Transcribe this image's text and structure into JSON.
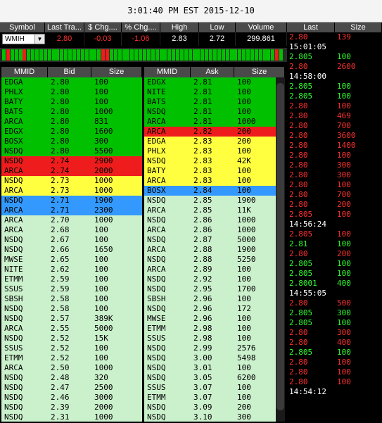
{
  "title": "3:01:40 PM EST 2015-12-10",
  "quote": {
    "headers": [
      "Symbol",
      "Last Tra...",
      "$ Chg....",
      "% Chg....",
      "High",
      "Low",
      "Volume"
    ],
    "symbol": "WMIH",
    "last": "2.80",
    "chg": "-0.03",
    "pct_chg": "-1.06",
    "high": "2.83",
    "low": "2.72",
    "volume": "299.861"
  },
  "colors": {
    "green": "#00c000",
    "red": "#ee1c1c",
    "yellow": "#ffff40",
    "blue": "#3399ff",
    "light_green": "#cbf0cc",
    "price_red": "#ff3030",
    "price_green": "#30ff30"
  },
  "tick_colors": [
    "g",
    "r",
    "g",
    "g",
    "g",
    "r",
    "g",
    "g",
    "g",
    "g",
    "g",
    "g",
    "g",
    "g",
    "g",
    "g",
    "g",
    "g",
    "g",
    "g",
    "g",
    "g",
    "g",
    "g",
    "r",
    "r",
    "g",
    "g",
    "g",
    "g",
    "g",
    "g",
    "g",
    "g",
    "g",
    "g",
    "g",
    "g",
    "g",
    "g",
    "g",
    "g",
    "g",
    "g",
    "g",
    "g",
    "g",
    "g",
    "g",
    "g",
    "g",
    "g",
    "g",
    "g",
    "g",
    "g",
    "g",
    "g",
    "g",
    "g",
    "g",
    "g",
    "g",
    "g",
    "g",
    "g",
    "r",
    "g"
  ],
  "bid_book": {
    "headers": [
      "MMID",
      "Bid",
      "Size"
    ],
    "rows": [
      {
        "mmid": "EDGA",
        "price": "2.80",
        "size": "100",
        "level": "green"
      },
      {
        "mmid": "PHLX",
        "price": "2.80",
        "size": "100",
        "level": "green"
      },
      {
        "mmid": "BATY",
        "price": "2.80",
        "size": "100",
        "level": "green"
      },
      {
        "mmid": "BATS",
        "price": "2.80",
        "size": "1000",
        "level": "green"
      },
      {
        "mmid": "ARCA",
        "price": "2.80",
        "size": "831",
        "level": "green"
      },
      {
        "mmid": "EDGX",
        "price": "2.80",
        "size": "1600",
        "level": "green"
      },
      {
        "mmid": "BOSX",
        "price": "2.80",
        "size": "300",
        "level": "green"
      },
      {
        "mmid": "NSDQ",
        "price": "2.80",
        "size": "5500",
        "level": "green"
      },
      {
        "mmid": "NSDQ",
        "price": "2.74",
        "size": "2900",
        "level": "red"
      },
      {
        "mmid": "ARCA",
        "price": "2.74",
        "size": "2000",
        "level": "red"
      },
      {
        "mmid": "NSDQ",
        "price": "2.73",
        "size": "1000",
        "level": "yellow"
      },
      {
        "mmid": "ARCA",
        "price": "2.73",
        "size": "1000",
        "level": "yellow"
      },
      {
        "mmid": "NSDQ",
        "price": "2.71",
        "size": "1900",
        "level": "blue"
      },
      {
        "mmid": "ARCA",
        "price": "2.71",
        "size": "2300",
        "level": "blue"
      },
      {
        "mmid": "ARCA",
        "price": "2.70",
        "size": "1000",
        "level": "light"
      },
      {
        "mmid": "ARCA",
        "price": "2.68",
        "size": "100",
        "level": "light"
      },
      {
        "mmid": "NSDQ",
        "price": "2.67",
        "size": "100",
        "level": "light"
      },
      {
        "mmid": "NSDQ",
        "price": "2.66",
        "size": "1650",
        "level": "light"
      },
      {
        "mmid": "MWSE",
        "price": "2.65",
        "size": "100",
        "level": "light"
      },
      {
        "mmid": "NITE",
        "price": "2.62",
        "size": "100",
        "level": "light"
      },
      {
        "mmid": "ETMM",
        "price": "2.59",
        "size": "100",
        "level": "light"
      },
      {
        "mmid": "SSUS",
        "price": "2.59",
        "size": "100",
        "level": "light"
      },
      {
        "mmid": "SBSH",
        "price": "2.58",
        "size": "100",
        "level": "light"
      },
      {
        "mmid": "NSDQ",
        "price": "2.58",
        "size": "100",
        "level": "light"
      },
      {
        "mmid": "NSDQ",
        "price": "2.57",
        "size": "389K",
        "level": "light"
      },
      {
        "mmid": "ARCA",
        "price": "2.55",
        "size": "5000",
        "level": "light"
      },
      {
        "mmid": "NSDQ",
        "price": "2.52",
        "size": "15K",
        "level": "light"
      },
      {
        "mmid": "SSUS",
        "price": "2.52",
        "size": "100",
        "level": "light"
      },
      {
        "mmid": "ETMM",
        "price": "2.52",
        "size": "100",
        "level": "light"
      },
      {
        "mmid": "ARCA",
        "price": "2.50",
        "size": "1000",
        "level": "light"
      },
      {
        "mmid": "NSDQ",
        "price": "2.48",
        "size": "320",
        "level": "light"
      },
      {
        "mmid": "NSDQ",
        "price": "2.47",
        "size": "2500",
        "level": "light"
      },
      {
        "mmid": "NSDQ",
        "price": "2.46",
        "size": "3000",
        "level": "light"
      },
      {
        "mmid": "NSDQ",
        "price": "2.39",
        "size": "2000",
        "level": "light"
      },
      {
        "mmid": "NSDQ",
        "price": "2.31",
        "size": "1000",
        "level": "light"
      }
    ]
  },
  "ask_book": {
    "headers": [
      "MMID",
      "Ask",
      "Size"
    ],
    "rows": [
      {
        "mmid": "EDGX",
        "price": "2.81",
        "size": "100",
        "level": "green"
      },
      {
        "mmid": "NITE",
        "price": "2.81",
        "size": "100",
        "level": "green"
      },
      {
        "mmid": "BATS",
        "price": "2.81",
        "size": "100",
        "level": "green"
      },
      {
        "mmid": "NSDQ",
        "price": "2.81",
        "size": "100",
        "level": "green"
      },
      {
        "mmid": "ARCA",
        "price": "2.81",
        "size": "1000",
        "level": "green"
      },
      {
        "mmid": "ARCA",
        "price": "2.82",
        "size": "200",
        "level": "red"
      },
      {
        "mmid": "EDGA",
        "price": "2.83",
        "size": "200",
        "level": "yellow"
      },
      {
        "mmid": "PHLX",
        "price": "2.83",
        "size": "100",
        "level": "yellow"
      },
      {
        "mmid": "NSDQ",
        "price": "2.83",
        "size": "42K",
        "level": "yellow"
      },
      {
        "mmid": "BATY",
        "price": "2.83",
        "size": "100",
        "level": "yellow"
      },
      {
        "mmid": "ARCA",
        "price": "2.83",
        "size": "100",
        "level": "yellow"
      },
      {
        "mmid": "BOSX",
        "price": "2.84",
        "size": "100",
        "level": "blue"
      },
      {
        "mmid": "NSDQ",
        "price": "2.85",
        "size": "1900",
        "level": "light"
      },
      {
        "mmid": "ARCA",
        "price": "2.85",
        "size": "11K",
        "level": "light"
      },
      {
        "mmid": "NSDQ",
        "price": "2.86",
        "size": "1000",
        "level": "light"
      },
      {
        "mmid": "ARCA",
        "price": "2.86",
        "size": "1000",
        "level": "light"
      },
      {
        "mmid": "NSDQ",
        "price": "2.87",
        "size": "5000",
        "level": "light"
      },
      {
        "mmid": "ARCA",
        "price": "2.88",
        "size": "1900",
        "level": "light"
      },
      {
        "mmid": "NSDQ",
        "price": "2.88",
        "size": "5250",
        "level": "light"
      },
      {
        "mmid": "ARCA",
        "price": "2.89",
        "size": "100",
        "level": "light"
      },
      {
        "mmid": "NSDQ",
        "price": "2.92",
        "size": "100",
        "level": "light"
      },
      {
        "mmid": "NSDQ",
        "price": "2.95",
        "size": "1700",
        "level": "light"
      },
      {
        "mmid": "SBSH",
        "price": "2.96",
        "size": "100",
        "level": "light"
      },
      {
        "mmid": "NSDQ",
        "price": "2.96",
        "size": "172",
        "level": "light"
      },
      {
        "mmid": "MWSE",
        "price": "2.96",
        "size": "100",
        "level": "light"
      },
      {
        "mmid": "ETMM",
        "price": "2.98",
        "size": "100",
        "level": "light"
      },
      {
        "mmid": "SSUS",
        "price": "2.98",
        "size": "100",
        "level": "light"
      },
      {
        "mmid": "NSDQ",
        "price": "2.99",
        "size": "2576",
        "level": "light"
      },
      {
        "mmid": "NSDQ",
        "price": "3.00",
        "size": "5498",
        "level": "light"
      },
      {
        "mmid": "NSDQ",
        "price": "3.01",
        "size": "100",
        "level": "light"
      },
      {
        "mmid": "NSDQ",
        "price": "3.05",
        "size": "6200",
        "level": "light"
      },
      {
        "mmid": "SSUS",
        "price": "3.07",
        "size": "100",
        "level": "light"
      },
      {
        "mmid": "ETMM",
        "price": "3.07",
        "size": "100",
        "level": "light"
      },
      {
        "mmid": "NSDQ",
        "price": "3.09",
        "size": "200",
        "level": "light"
      },
      {
        "mmid": "NSDQ",
        "price": "3.10",
        "size": "300",
        "level": "light"
      }
    ]
  },
  "time_sales": {
    "headers": [
      "Last",
      "Size"
    ],
    "rows": [
      {
        "type": "trade",
        "price": "2.80",
        "size": "139",
        "color": "red"
      },
      {
        "type": "time",
        "text": "15:01:05"
      },
      {
        "type": "trade",
        "price": "2.805",
        "size": "100",
        "color": "green"
      },
      {
        "type": "trade",
        "price": "2.80",
        "size": "2600",
        "color": "red"
      },
      {
        "type": "time",
        "text": "14:58:00"
      },
      {
        "type": "trade",
        "price": "2.805",
        "size": "100",
        "color": "green"
      },
      {
        "type": "trade",
        "price": "2.805",
        "size": "100",
        "color": "green"
      },
      {
        "type": "trade",
        "price": "2.80",
        "size": "100",
        "color": "red"
      },
      {
        "type": "trade",
        "price": "2.80",
        "size": "469",
        "color": "red"
      },
      {
        "type": "trade",
        "price": "2.80",
        "size": "700",
        "color": "red"
      },
      {
        "type": "trade",
        "price": "2.80",
        "size": "3600",
        "color": "red"
      },
      {
        "type": "trade",
        "price": "2.80",
        "size": "1400",
        "color": "red"
      },
      {
        "type": "trade",
        "price": "2.80",
        "size": "100",
        "color": "red"
      },
      {
        "type": "trade",
        "price": "2.80",
        "size": "300",
        "color": "red"
      },
      {
        "type": "trade",
        "price": "2.80",
        "size": "300",
        "color": "red"
      },
      {
        "type": "trade",
        "price": "2.80",
        "size": "100",
        "color": "red"
      },
      {
        "type": "trade",
        "price": "2.80",
        "size": "700",
        "color": "red"
      },
      {
        "type": "trade",
        "price": "2.80",
        "size": "200",
        "color": "red"
      },
      {
        "type": "trade",
        "price": "2.805",
        "size": "100",
        "color": "red"
      },
      {
        "type": "time",
        "text": "14:56:24"
      },
      {
        "type": "trade",
        "price": "2.805",
        "size": "100",
        "color": "red"
      },
      {
        "type": "trade",
        "price": "2.81",
        "size": "100",
        "color": "green"
      },
      {
        "type": "trade",
        "price": "2.80",
        "size": "200",
        "color": "red"
      },
      {
        "type": "trade",
        "price": "2.805",
        "size": "100",
        "color": "green"
      },
      {
        "type": "trade",
        "price": "2.805",
        "size": "100",
        "color": "green"
      },
      {
        "type": "trade",
        "price": "2.8001",
        "size": "400",
        "color": "green"
      },
      {
        "type": "time",
        "text": "14:55:05"
      },
      {
        "type": "trade",
        "price": "2.80",
        "size": "500",
        "color": "red"
      },
      {
        "type": "trade",
        "price": "2.805",
        "size": "300",
        "color": "green"
      },
      {
        "type": "trade",
        "price": "2.805",
        "size": "100",
        "color": "green"
      },
      {
        "type": "trade",
        "price": "2.80",
        "size": "300",
        "color": "red"
      },
      {
        "type": "trade",
        "price": "2.80",
        "size": "400",
        "color": "red"
      },
      {
        "type": "trade",
        "price": "2.805",
        "size": "100",
        "color": "green"
      },
      {
        "type": "trade",
        "price": "2.80",
        "size": "100",
        "color": "red"
      },
      {
        "type": "trade",
        "price": "2.80",
        "size": "100",
        "color": "red"
      },
      {
        "type": "trade",
        "price": "2.80",
        "size": "100",
        "color": "red"
      },
      {
        "type": "time",
        "text": "14:54:12"
      }
    ]
  }
}
